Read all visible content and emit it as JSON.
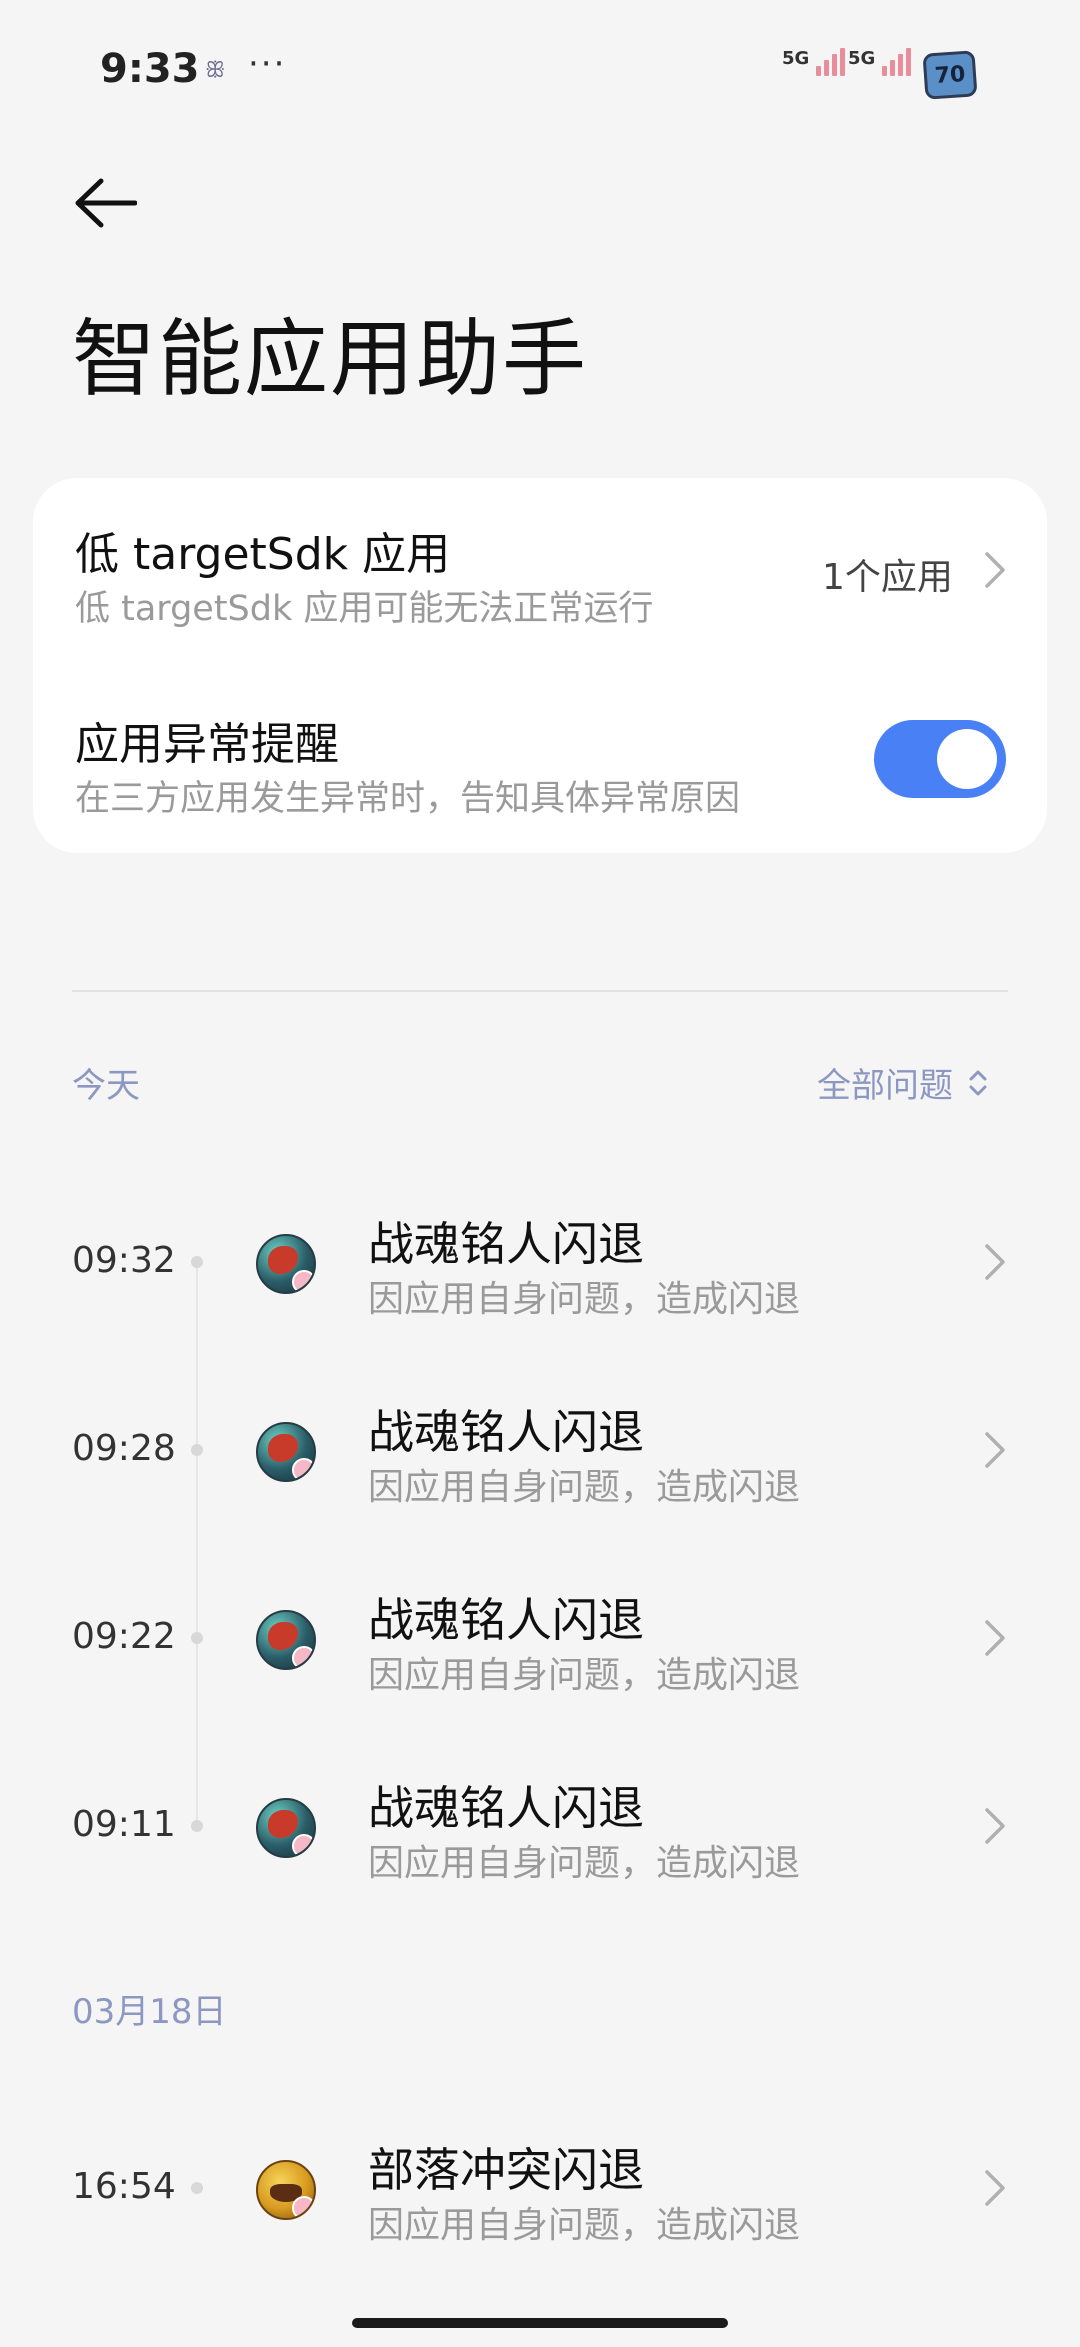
{
  "status_bar": {
    "time": "9:33",
    "notif_glyph": "ꕥ",
    "overflow": "···",
    "signal1": "5G",
    "signal2": "5G",
    "battery": "70"
  },
  "header": {
    "title": "智能应用助手"
  },
  "settings": {
    "low_sdk": {
      "title": "低 targetSdk 应用",
      "subtitle": "低 targetSdk 应用可能无法正常运行",
      "value": "1个应用"
    },
    "alert": {
      "title": "应用异常提醒",
      "subtitle": "在三方应用发生异常时，告知具体异常原因",
      "enabled": true
    }
  },
  "log": {
    "filter_label": "全部问题",
    "sections": [
      {
        "date": "今天",
        "items": [
          {
            "time": "09:32",
            "title": "战魂铭人闪退",
            "subtitle": "因应用自身问题，造成闪退",
            "icon": "soul-knight-app-icon"
          },
          {
            "time": "09:28",
            "title": "战魂铭人闪退",
            "subtitle": "因应用自身问题，造成闪退",
            "icon": "soul-knight-app-icon"
          },
          {
            "time": "09:22",
            "title": "战魂铭人闪退",
            "subtitle": "因应用自身问题，造成闪退",
            "icon": "soul-knight-app-icon"
          },
          {
            "time": "09:11",
            "title": "战魂铭人闪退",
            "subtitle": "因应用自身问题，造成闪退",
            "icon": "soul-knight-app-icon"
          }
        ]
      },
      {
        "date": "03月18日",
        "items": [
          {
            "time": "16:54",
            "title": "部落冲突闪退",
            "subtitle": "因应用自身问题，造成闪退",
            "icon": "clash-of-clans-app-icon"
          }
        ]
      }
    ]
  },
  "colors": {
    "accent": "#4a80f5",
    "background": "#f5f5f5",
    "section_label": "#8d98c2"
  }
}
